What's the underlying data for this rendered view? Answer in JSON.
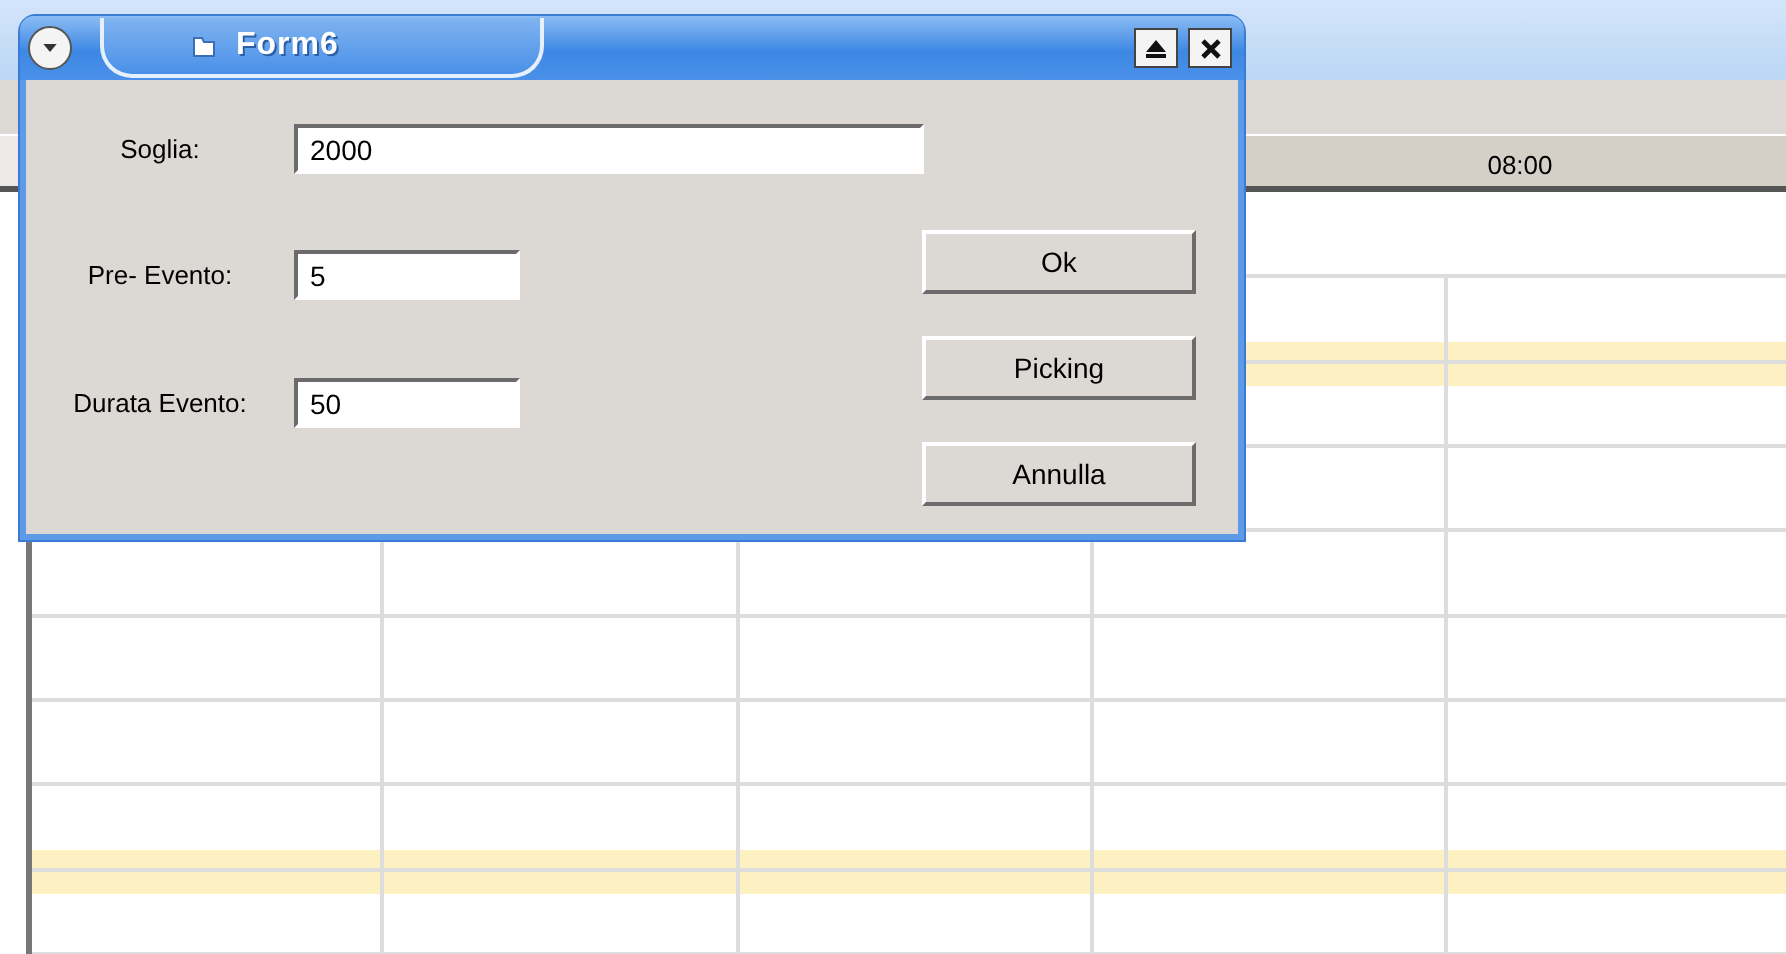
{
  "window": {
    "title": "Form6"
  },
  "fields": [
    {
      "label": "Soglia:",
      "value": "2000"
    },
    {
      "label": "Pre- Evento:",
      "value": "5"
    },
    {
      "label": "Durata Evento:",
      "value": "50"
    }
  ],
  "buttons": [
    "Ok",
    "Picking",
    "Annulla"
  ],
  "scheduler": {
    "time_header": "08:00"
  }
}
